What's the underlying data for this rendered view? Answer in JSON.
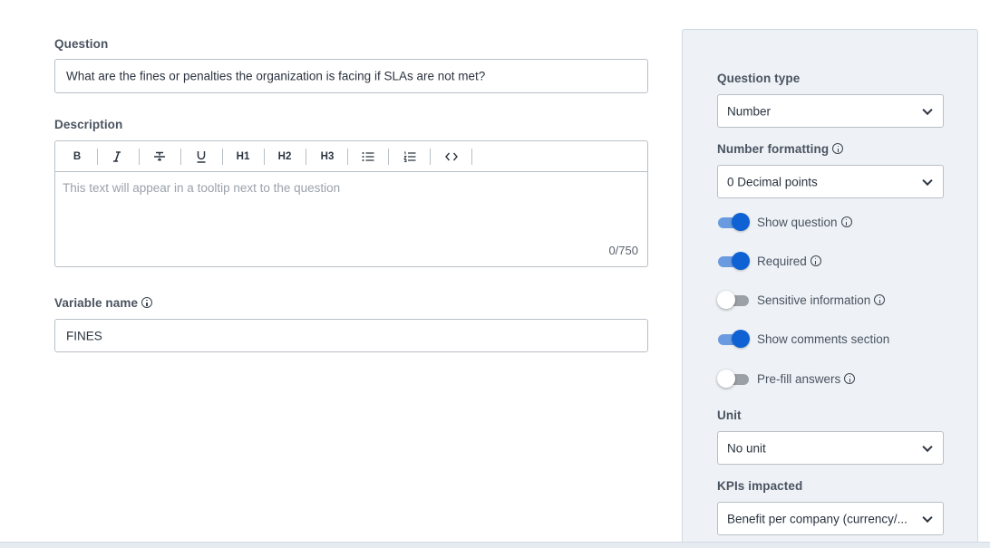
{
  "question": {
    "label": "Question",
    "value": "What are the fines or penalties the organization is facing if SLAs are not met?"
  },
  "description": {
    "label": "Description",
    "toolbar": [
      "B",
      "I",
      "S",
      "U",
      "H1",
      "H2",
      "H3",
      "bullet-list",
      "numbered-list",
      "code"
    ],
    "placeholder": "This text will appear in a tooltip next to the question",
    "counter": "0/750"
  },
  "variable": {
    "label": "Variable name",
    "value": "FINES"
  },
  "panel": {
    "question_type": {
      "label": "Question type",
      "selected": "Number"
    },
    "number_formatting": {
      "label": "Number formatting",
      "selected": "0 Decimal points"
    },
    "toggles": [
      {
        "label": "Show question",
        "on": true,
        "info": true
      },
      {
        "label": "Required",
        "on": true,
        "info": true
      },
      {
        "label": "Sensitive information",
        "on": false,
        "info": true
      },
      {
        "label": "Show comments section",
        "on": true,
        "info": false
      },
      {
        "label": "Pre-fill answers",
        "on": false,
        "info": true
      }
    ],
    "unit": {
      "label": "Unit",
      "selected": "No unit"
    },
    "kpis": {
      "label": "KPIs impacted",
      "selected": "Benefit per company (currency/..."
    }
  },
  "colors": {
    "toggle_on": "#0f62d4",
    "toggle_on_track": "#6a9ae0",
    "panel_bg": "#eef2f6"
  }
}
